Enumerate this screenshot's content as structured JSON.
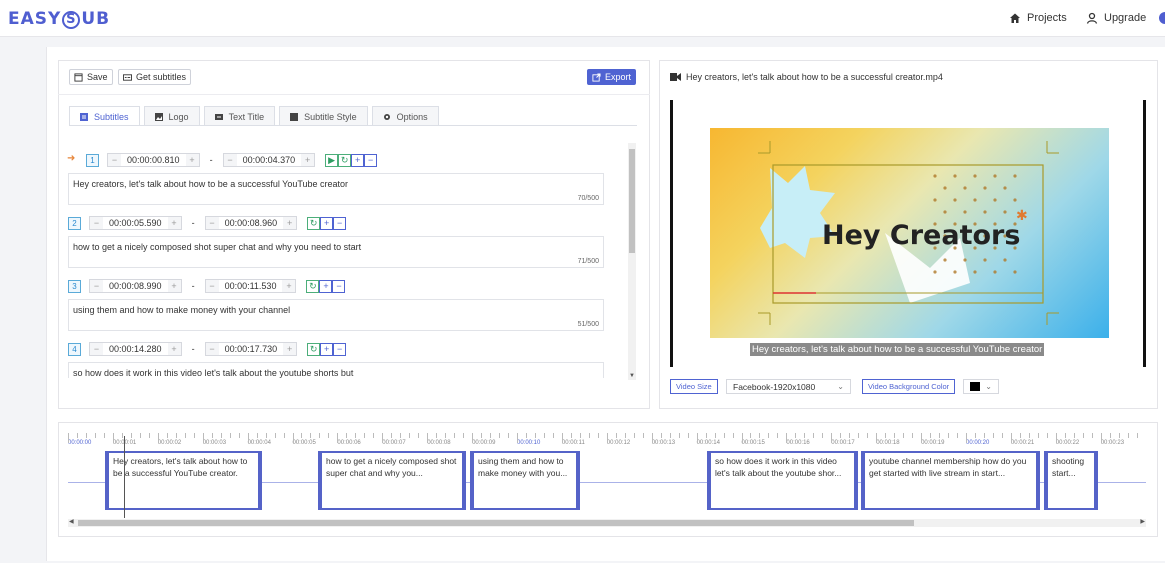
{
  "header": {
    "logo_text_1": "EASY",
    "logo_text_2": "S",
    "logo_text_3": "UB",
    "nav": [
      {
        "label": "Projects",
        "icon": "home-icon"
      },
      {
        "label": "Upgrade",
        "icon": "user-icon"
      }
    ]
  },
  "toolbar": {
    "save_label": "Save",
    "get_subtitles_label": "Get subtitles",
    "export_label": "Export"
  },
  "tabs": [
    {
      "label": "Subtitles",
      "icon": "list-icon",
      "active": true
    },
    {
      "label": "Logo",
      "icon": "image-icon"
    },
    {
      "label": "Text Title",
      "icon": "text-icon"
    },
    {
      "label": "Subtitle Style",
      "icon": "style-icon"
    },
    {
      "label": "Options",
      "icon": "gear-icon"
    }
  ],
  "subtitles": [
    {
      "num": "1",
      "start": "00:00:00.810",
      "end": "00:00:04.370",
      "text": "Hey creators, let's talk about how to be a successful YouTube creator",
      "count": "70/500",
      "current": true
    },
    {
      "num": "2",
      "start": "00:00:05.590",
      "end": "00:00:08.960",
      "text": "how to get a nicely composed shot super chat and why you need to start",
      "count": "71/500"
    },
    {
      "num": "3",
      "start": "00:00:08.990",
      "end": "00:00:11.530",
      "text": "using them and how to make money with your channel",
      "count": "51/500"
    },
    {
      "num": "4",
      "start": "00:00:14.280",
      "end": "00:00:17.730",
      "text": "so how does it work in this video let's talk about the youtube shorts but",
      "count": ""
    }
  ],
  "preview": {
    "filename": "Hey creators, let's talk about how to be a successful creator.mp4",
    "headline": "Hey Creators",
    "caption": "Hey creators, let's talk about how to be a successful YouTube creator",
    "video_size_label": "Video Size",
    "video_size_value": "Facebook-1920x1080",
    "bg_color_label": "Video Background Color",
    "bg_color_value": "#000000"
  },
  "timeline": {
    "ticks": [
      "00:00:00",
      "00:00:01",
      "00:00:02",
      "00:00:03",
      "00:00:04",
      "00:00:05",
      "00:00:06",
      "00:00:07",
      "00:00:08",
      "00:00:09",
      "00:00:10",
      "00:00:11",
      "00:00:12",
      "00:00:13",
      "00:00:14",
      "00:00:15",
      "00:00:16",
      "00:00:17",
      "00:00:18",
      "00:00:19",
      "00:00:20",
      "00:00:21",
      "00:00:22",
      "00:00:23"
    ],
    "clips": [
      {
        "text": "Hey creators, let's talk about how to be a successful YouTube creator."
      },
      {
        "text": "how to get a nicely composed shot super chat and why you..."
      },
      {
        "text": "using them and how to make money with you..."
      },
      {
        "text": "so how does it work in this video let's talk about the youtube shor..."
      },
      {
        "text": "youtube channel membership how do you get started with live stream in start..."
      },
      {
        "text": "shooting start..."
      }
    ]
  }
}
